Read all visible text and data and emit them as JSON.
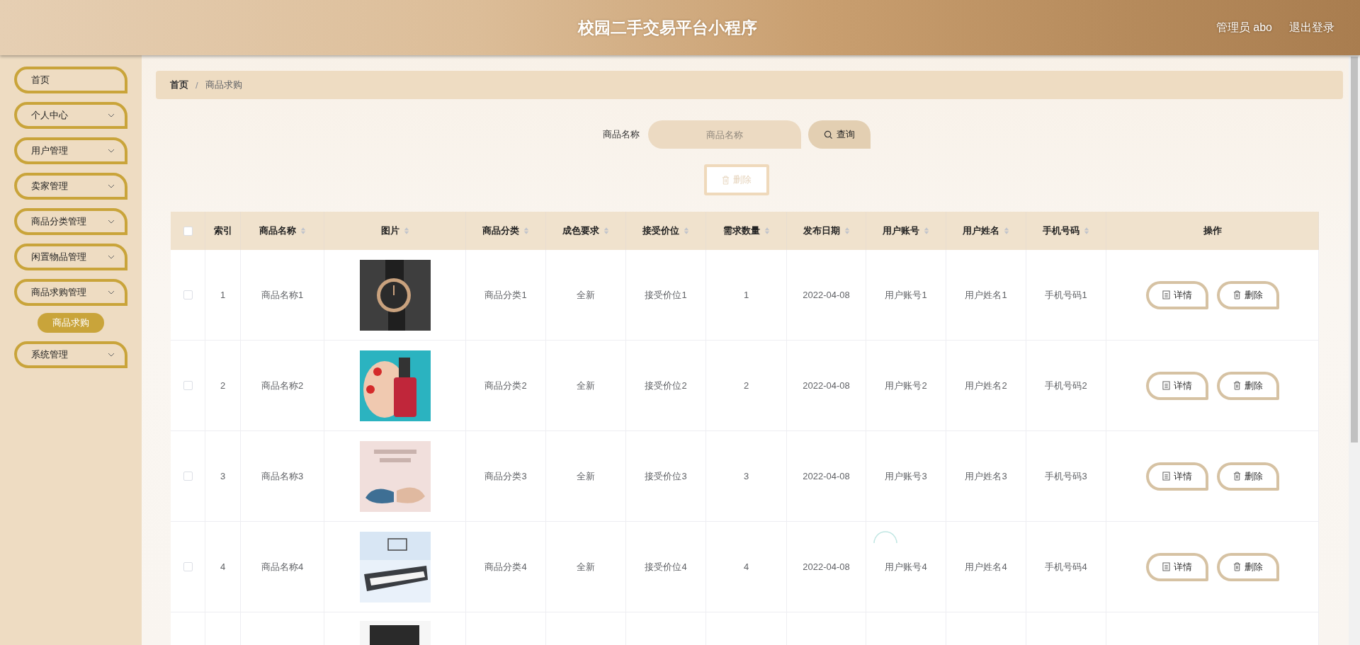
{
  "header": {
    "title": "校园二手交易平台小程序",
    "user": "管理员 abo",
    "logout": "退出登录"
  },
  "sidebar": {
    "items": [
      {
        "label": "首页",
        "kind": "link"
      },
      {
        "label": "个人中心",
        "kind": "submenu"
      },
      {
        "label": "用户管理",
        "kind": "submenu"
      },
      {
        "label": "卖家管理",
        "kind": "submenu"
      },
      {
        "label": "商品分类管理",
        "kind": "submenu"
      },
      {
        "label": "闲置物品管理",
        "kind": "submenu"
      },
      {
        "label": "商品求购管理",
        "kind": "submenu",
        "children": [
          {
            "label": "商品求购",
            "selected": true
          }
        ]
      },
      {
        "label": "系统管理",
        "kind": "submenu"
      }
    ]
  },
  "breadcrumb": [
    "首页",
    "商品求购"
  ],
  "breadcrumb_separator": "/",
  "search": {
    "label": "商品名称",
    "placeholder": "商品名称",
    "button": "查询"
  },
  "bulk_delete": {
    "label": "删除",
    "disabled": true
  },
  "table": {
    "select_all": {
      "checked": false
    },
    "columns": [
      {
        "label": "索引",
        "sortable": false
      },
      {
        "label": "商品名称",
        "sortable": true
      },
      {
        "label": "图片",
        "sortable": true
      },
      {
        "label": "商品分类",
        "sortable": true
      },
      {
        "label": "成色要求",
        "sortable": true
      },
      {
        "label": "接受价位",
        "sortable": true
      },
      {
        "label": "需求数量",
        "sortable": true
      },
      {
        "label": "发布日期",
        "sortable": true
      },
      {
        "label": "用户账号",
        "sortable": true
      },
      {
        "label": "用户姓名",
        "sortable": true
      },
      {
        "label": "手机号码",
        "sortable": true
      },
      {
        "label": "操作",
        "sortable": false
      }
    ],
    "rows": [
      {
        "checked": false,
        "cells": [
          "1",
          "商品名称1",
          {
            "kind": "picture"
          },
          "商品分类1",
          "全新",
          "接受价位1",
          "1",
          "2022-04-08",
          "用户账号1",
          "用户姓名1",
          "手机号码1"
        ],
        "actions": [
          "详情",
          "删除"
        ]
      },
      {
        "checked": false,
        "cells": [
          "2",
          "商品名称2",
          {
            "kind": "picture"
          },
          "商品分类2",
          "全新",
          "接受价位2",
          "2",
          "2022-04-08",
          "用户账号2",
          "用户姓名2",
          "手机号码2"
        ],
        "actions": [
          "详情",
          "删除"
        ]
      },
      {
        "checked": false,
        "cells": [
          "3",
          "商品名称3",
          {
            "kind": "picture"
          },
          "商品分类3",
          "全新",
          "接受价位3",
          "3",
          "2022-04-08",
          "用户账号3",
          "用户姓名3",
          "手机号码3"
        ],
        "actions": [
          "详情",
          "删除"
        ]
      },
      {
        "checked": false,
        "cells": [
          "4",
          "商品名称4",
          {
            "kind": "picture"
          },
          "商品分类4",
          "全新",
          "接受价位4",
          "4",
          "2022-04-08",
          "用户账号4",
          "用户姓名4",
          "手机号码4"
        ],
        "actions": [
          "详情",
          "删除"
        ]
      }
    ]
  }
}
